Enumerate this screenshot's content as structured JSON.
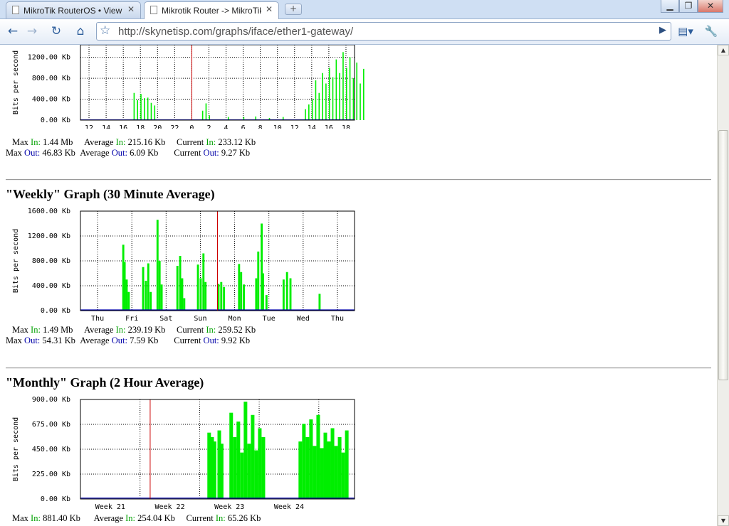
{
  "browser": {
    "tabs": [
      {
        "label": "MikroTik RouterOS • View t...",
        "active": false
      },
      {
        "label": "Mikrotik Router -> MikroTik ...",
        "active": true
      }
    ],
    "url": "http://skynetisp.com/graphs/iface/ether1-gateway/"
  },
  "daily": {
    "chart_data": {
      "type": "area",
      "ylabel": "Bits per second",
      "y_ticks": [
        "1200.00 Kb",
        "800.00 Kb",
        "400.00 Kb",
        "0.00 Kb"
      ],
      "ylim": [
        0,
        1440
      ],
      "x_ticks": [
        "12",
        "14",
        "16",
        "18",
        "20",
        "22",
        "0",
        "2",
        "4",
        "6",
        "8",
        "10",
        "12",
        "14",
        "16",
        "18"
      ],
      "series": [
        {
          "name": "In",
          "color": "#00ee00",
          "peaks": [
            [
              3.0,
              0
            ],
            [
              3.1,
              520
            ],
            [
              3.3,
              380
            ],
            [
              3.5,
              500
            ],
            [
              3.7,
              420
            ],
            [
              3.9,
              430
            ],
            [
              4.1,
              330
            ],
            [
              4.3,
              280
            ],
            [
              4.5,
              0
            ],
            [
              6.9,
              0
            ],
            [
              7.1,
              180
            ],
            [
              7.3,
              320
            ],
            [
              7.5,
              90
            ],
            [
              7.7,
              0
            ],
            [
              8.6,
              60
            ],
            [
              9.5,
              60
            ],
            [
              10.2,
              70
            ],
            [
              11.0,
              40
            ],
            [
              11.8,
              60
            ],
            [
              12.9,
              0
            ],
            [
              13.1,
              210
            ],
            [
              13.3,
              300
            ],
            [
              13.5,
              400
            ],
            [
              13.7,
              760
            ],
            [
              13.9,
              520
            ],
            [
              14.1,
              900
            ],
            [
              14.3,
              700
            ],
            [
              14.5,
              1000
            ],
            [
              14.7,
              820
            ],
            [
              14.9,
              1160
            ],
            [
              15.1,
              900
            ],
            [
              15.3,
              1300
            ],
            [
              15.5,
              1000
            ],
            [
              15.7,
              1200
            ],
            [
              15.9,
              800
            ],
            [
              16.1,
              1100
            ],
            [
              16.3,
              700
            ],
            [
              16.5,
              980
            ],
            [
              16.7,
              560
            ],
            [
              16.9,
              900
            ],
            [
              17.1,
              640
            ],
            [
              17.3,
              800
            ],
            [
              17.5,
              500
            ],
            [
              17.7,
              760
            ],
            [
              17.9,
              560
            ],
            [
              18.1,
              920
            ],
            [
              18.3,
              600
            ],
            [
              18.5,
              880
            ],
            [
              18.7,
              540
            ],
            [
              18.9,
              860
            ],
            [
              19.1,
              300
            ],
            [
              19.3,
              0
            ],
            [
              20.2,
              20
            ],
            [
              21.0,
              30
            ],
            [
              22.0,
              20
            ],
            [
              23.0,
              30
            ],
            [
              23.8,
              0
            ],
            [
              23.85,
              1200
            ],
            [
              23.95,
              80
            ]
          ]
        },
        {
          "name": "Out",
          "color": "#0000aa",
          "level": 6
        }
      ],
      "current_marker": "0"
    },
    "stats": {
      "row1": {
        "max": "1.44 Mb",
        "avg": "215.16 Kb",
        "cur": "233.12 Kb"
      },
      "row2": {
        "max": "46.83 Kb",
        "avg": "6.09 Kb",
        "cur": "9.27 Kb"
      }
    }
  },
  "weekly": {
    "title": "\"Weekly\" Graph (30 Minute Average)",
    "chart_data": {
      "type": "area",
      "ylabel": "Bits per second",
      "y_ticks": [
        "1600.00 Kb",
        "1200.00 Kb",
        "800.00 Kb",
        "400.00 Kb",
        "0.00 Kb"
      ],
      "ylim": [
        0,
        1600
      ],
      "x_ticks": [
        "Thu",
        "Fri",
        "Sat",
        "Sun",
        "Mon",
        "Tue",
        "Wed",
        "Thu"
      ],
      "series": [
        {
          "name": "In",
          "color": "#00ee00",
          "peaks": [
            [
              1.2,
              0
            ],
            [
              1.22,
              1060
            ],
            [
              1.26,
              780
            ],
            [
              1.32,
              500
            ],
            [
              1.38,
              300
            ],
            [
              1.44,
              0
            ],
            [
              1.75,
              0
            ],
            [
              1.8,
              700
            ],
            [
              1.88,
              480
            ],
            [
              1.95,
              760
            ],
            [
              2.02,
              300
            ],
            [
              2.08,
              0
            ],
            [
              2.2,
              0
            ],
            [
              2.22,
              1460
            ],
            [
              2.28,
              800
            ],
            [
              2.34,
              420
            ],
            [
              2.4,
              0
            ],
            [
              2.75,
              0
            ],
            [
              2.8,
              720
            ],
            [
              2.88,
              880
            ],
            [
              2.94,
              520
            ],
            [
              3.0,
              200
            ],
            [
              3.08,
              0
            ],
            [
              3.35,
              0
            ],
            [
              3.4,
              740
            ],
            [
              3.48,
              520
            ],
            [
              3.56,
              920
            ],
            [
              3.62,
              460
            ],
            [
              3.7,
              0
            ],
            [
              3.95,
              0
            ],
            [
              4.0,
              430
            ],
            [
              4.08,
              460
            ],
            [
              4.16,
              380
            ],
            [
              4.26,
              0
            ],
            [
              4.55,
              0
            ],
            [
              4.6,
              750
            ],
            [
              4.66,
              620
            ],
            [
              4.74,
              420
            ],
            [
              4.82,
              0
            ],
            [
              5.05,
              0
            ],
            [
              5.1,
              520
            ],
            [
              5.16,
              950
            ],
            [
              5.26,
              1400
            ],
            [
              5.3,
              600
            ],
            [
              5.4,
              250
            ],
            [
              5.48,
              0
            ],
            [
              5.85,
              0
            ],
            [
              5.9,
              500
            ],
            [
              6.0,
              620
            ],
            [
              6.1,
              520
            ],
            [
              6.2,
              0
            ],
            [
              6.9,
              0
            ],
            [
              6.95,
              270
            ]
          ]
        },
        {
          "name": "Out",
          "color": "#0000aa",
          "level": 12
        }
      ],
      "current_marker": "Sun"
    },
    "stats": {
      "row1": {
        "max": "1.49 Mb",
        "avg": "239.19 Kb",
        "cur": "259.52 Kb"
      },
      "row2": {
        "max": "54.31 Kb",
        "avg": "7.59 Kb",
        "cur": "9.92 Kb"
      }
    }
  },
  "monthly": {
    "title": "\"Monthly\" Graph (2 Hour Average)",
    "chart_data": {
      "type": "area",
      "ylabel": "Bits per second",
      "y_ticks": [
        "900.00 Kb",
        "675.00 Kb",
        "450.00 Kb",
        "225.00 Kb",
        "0.00 Kb"
      ],
      "ylim": [
        0,
        900
      ],
      "x_ticks": [
        "Week 21",
        "Week 22",
        "Week 23",
        "Week 24"
      ],
      "series": [
        {
          "name": "In",
          "color": "#00ee00",
          "peaks": [
            [
              2.12,
              0
            ],
            [
              2.13,
              600
            ],
            [
              2.18,
              560
            ],
            [
              2.22,
              520
            ],
            [
              2.26,
              0
            ],
            [
              2.3,
              620
            ],
            [
              2.34,
              500
            ],
            [
              2.38,
              0
            ],
            [
              2.45,
              0
            ],
            [
              2.5,
              780
            ],
            [
              2.56,
              560
            ],
            [
              2.62,
              700
            ],
            [
              2.68,
              420
            ],
            [
              2.74,
              880
            ],
            [
              2.8,
              500
            ],
            [
              2.86,
              760
            ],
            [
              2.92,
              440
            ],
            [
              2.98,
              640
            ],
            [
              3.04,
              560
            ],
            [
              3.08,
              0
            ],
            [
              3.62,
              0
            ],
            [
              3.66,
              520
            ],
            [
              3.72,
              680
            ],
            [
              3.78,
              560
            ],
            [
              3.84,
              720
            ],
            [
              3.9,
              480
            ],
            [
              3.96,
              760
            ],
            [
              4.02,
              460
            ],
            [
              4.08,
              600
            ],
            [
              4.14,
              520
            ],
            [
              4.2,
              640
            ],
            [
              4.26,
              480
            ],
            [
              4.32,
              560
            ],
            [
              4.38,
              420
            ],
            [
              4.44,
              620
            ],
            [
              4.48,
              0
            ]
          ]
        },
        {
          "name": "Out",
          "color": "#0000aa",
          "level": 8
        }
      ],
      "current_marker": "Week 22"
    },
    "stats": {
      "row1": {
        "max": "881.40 Kb",
        "avg": "254.04 Kb",
        "cur": "65.26 Kb"
      }
    }
  },
  "labels": {
    "max": "Max",
    "average": "Average",
    "current": "Current",
    "in": "In:",
    "out": "Out:"
  }
}
